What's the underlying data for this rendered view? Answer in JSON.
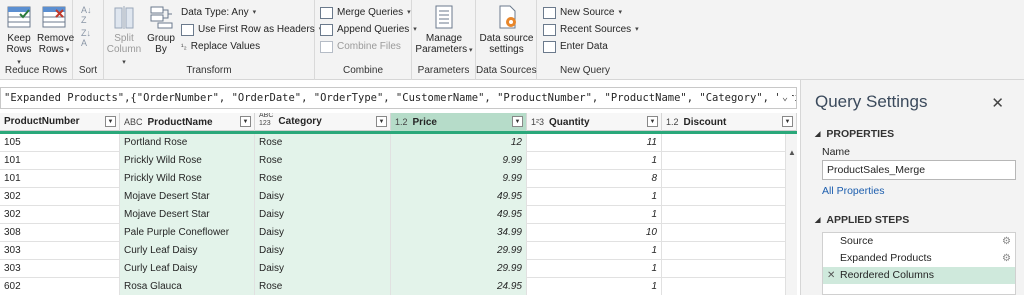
{
  "ribbon": {
    "reduce_rows": {
      "label": "Reduce Rows",
      "keep": "Keep\nRows",
      "remove": "Remove\nRows"
    },
    "sort": {
      "label": "Sort"
    },
    "transform": {
      "label": "Transform",
      "split_column": "Split\nColumn",
      "group_by": "Group\nBy",
      "data_type": "Data Type: Any",
      "use_first_row": "Use First Row as Headers",
      "replace_values": "Replace Values"
    },
    "combine": {
      "label": "Combine",
      "merge_queries": "Merge Queries",
      "append_queries": "Append Queries",
      "combine_files": "Combine Files"
    },
    "parameters": {
      "label": "Parameters",
      "manage": "Manage\nParameters"
    },
    "data_sources": {
      "label": "Data Sources",
      "settings": "Data source\nsettings"
    },
    "new_query": {
      "label": "New Query",
      "new_source": "New Source",
      "recent_sources": "Recent Sources",
      "enter_data": "Enter Data"
    }
  },
  "formula": "\"Expanded Products\",{\"OrderNumber\", \"OrderDate\", \"OrderType\", \"CustomerName\", \"ProductNumber\", \"ProductName\", \"Category\", \"Price\",",
  "columns": [
    {
      "name": "ProductNumber",
      "type": ""
    },
    {
      "name": "ProductName",
      "type": "ABC"
    },
    {
      "name": "Category",
      "type": "ABC\n123"
    },
    {
      "name": "Price",
      "type": "1.2"
    },
    {
      "name": "Quantity",
      "type": "1²3"
    },
    {
      "name": "Discount",
      "type": "1.2"
    }
  ],
  "rows": [
    [
      "105",
      "Portland Rose",
      "Rose",
      "12",
      "11",
      ""
    ],
    [
      "101",
      "Prickly Wild Rose",
      "Rose",
      "9.99",
      "1",
      ""
    ],
    [
      "101",
      "Prickly Wild Rose",
      "Rose",
      "9.99",
      "8",
      ""
    ],
    [
      "302",
      "Mojave Desert Star",
      "Daisy",
      "49.95",
      "1",
      ""
    ],
    [
      "302",
      "Mojave Desert Star",
      "Daisy",
      "49.95",
      "1",
      ""
    ],
    [
      "308",
      "Pale Purple Coneflower",
      "Daisy",
      "34.99",
      "10",
      ""
    ],
    [
      "303",
      "Curly Leaf Daisy",
      "Daisy",
      "29.99",
      "1",
      ""
    ],
    [
      "303",
      "Curly Leaf Daisy",
      "Daisy",
      "29.99",
      "1",
      ""
    ],
    [
      "602",
      "Rosa Glauca",
      "Rose",
      "24.95",
      "1",
      ""
    ]
  ],
  "query_settings": {
    "title": "Query Settings",
    "properties_label": "PROPERTIES",
    "name_label": "Name",
    "name_value": "ProductSales_Merge",
    "all_properties": "All Properties",
    "applied_steps_label": "APPLIED STEPS",
    "steps": [
      "Source",
      "Expanded Products",
      "Reordered Columns"
    ]
  },
  "colors": {
    "accent_green": "#2aa87a",
    "selected_col": "#b6dcc9",
    "link": "#1c5eae"
  }
}
